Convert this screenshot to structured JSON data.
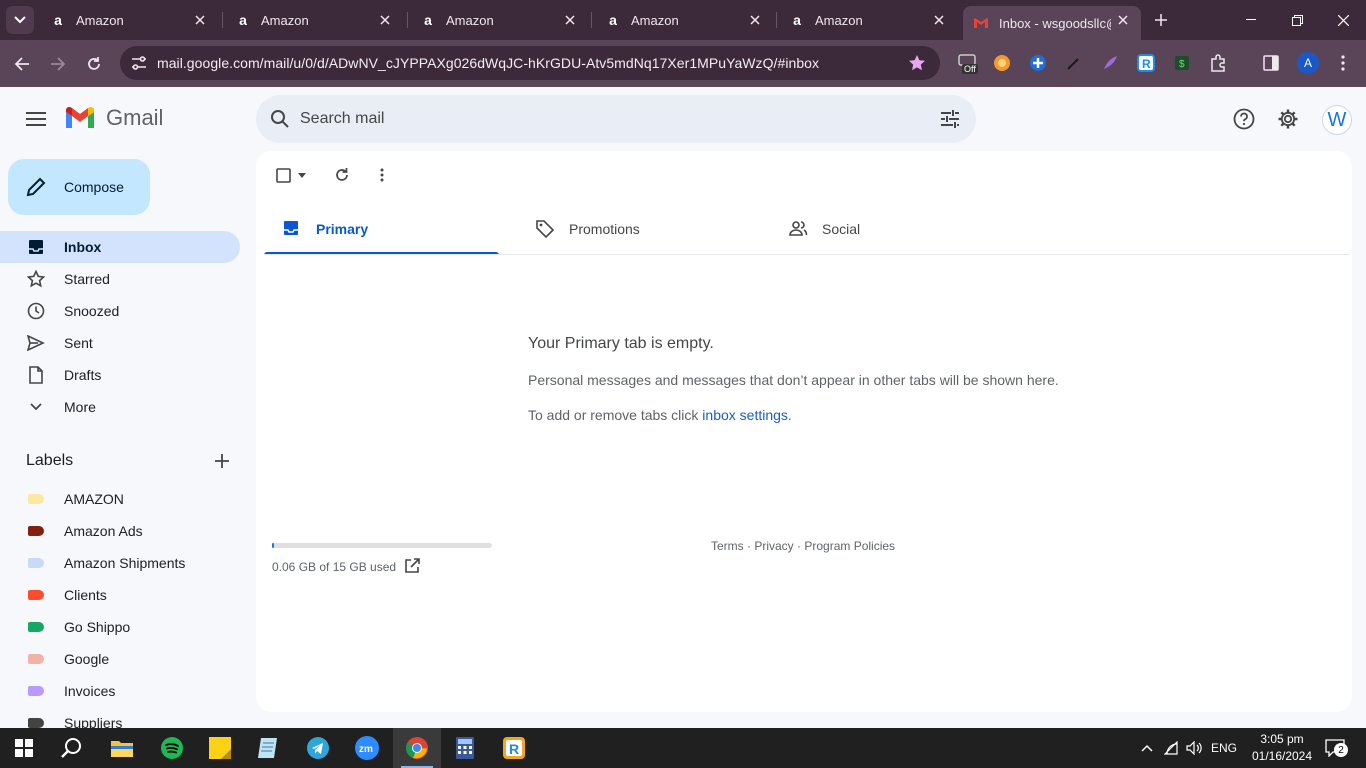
{
  "browser": {
    "tabs": [
      {
        "title": "Amazon",
        "favicon": "amazon-a-icon"
      },
      {
        "title": "Amazon",
        "favicon": "amazon-a-icon"
      },
      {
        "title": "Amazon",
        "favicon": "amazon-a-icon"
      },
      {
        "title": "Amazon",
        "favicon": "amazon-a-icon"
      },
      {
        "title": "Amazon",
        "favicon": "amazon-a-icon"
      },
      {
        "title": "Inbox - wsgoodsllc@",
        "favicon": "gmail-icon",
        "active": true
      }
    ],
    "url": "mail.google.com/mail/u/0/d/ADwNV_cJYPPAXg026dWqJC-hKrGDU-Atv5mdNq17Xer1MPuYaWzQ/#inbox",
    "extension_badge": "Off",
    "profile_initial": "A"
  },
  "gmail": {
    "logo_text": "Gmail",
    "search_placeholder": "Search mail",
    "avatar_initial": "W",
    "compose_label": "Compose",
    "nav": [
      {
        "label": "Inbox",
        "icon": "inbox-icon",
        "active": true
      },
      {
        "label": "Starred",
        "icon": "star-icon"
      },
      {
        "label": "Snoozed",
        "icon": "clock-icon"
      },
      {
        "label": "Sent",
        "icon": "send-icon"
      },
      {
        "label": "Drafts",
        "icon": "draft-icon"
      },
      {
        "label": "More",
        "icon": "chevron-down-icon"
      }
    ],
    "labels_header": "Labels",
    "labels": [
      {
        "name": "AMAZON",
        "color": "#fce8a3"
      },
      {
        "name": "Amazon Ads",
        "color": "#822111"
      },
      {
        "name": "Amazon Shipments",
        "color": "#c9daf8"
      },
      {
        "name": "Clients",
        "color": "#fb4c2f"
      },
      {
        "name": "Go Shippo",
        "color": "#16a765"
      },
      {
        "name": "Google",
        "color": "#f2b2a8"
      },
      {
        "name": "Invoices",
        "color": "#b99aff"
      },
      {
        "name": "Suppliers",
        "color": "#434343"
      }
    ],
    "category_tabs": [
      {
        "label": "Primary",
        "icon": "inbox-tab-icon",
        "active": true
      },
      {
        "label": "Promotions",
        "icon": "tag-icon"
      },
      {
        "label": "Social",
        "icon": "people-icon"
      }
    ],
    "empty_state": {
      "title": "Your Primary tab is empty.",
      "description": "Personal messages and messages that don’t appear in other tabs will be shown here.",
      "hint_prefix": "To add or remove tabs click ",
      "hint_link": "inbox settings",
      "hint_suffix": "."
    },
    "storage": {
      "text": "0.06 GB of 15 GB used",
      "used_fraction": 0.004
    },
    "footer": {
      "terms": "Terms",
      "privacy": "Privacy",
      "policies": "Program Policies",
      "separator": " · "
    }
  },
  "taskbar": {
    "language": "ENG",
    "time": "3:05 pm",
    "date": "01/16/2024",
    "notification_count": "2"
  },
  "colors": {
    "chrome_dark": "#3c2a3a",
    "chrome_toolbar": "#5a4558",
    "compose_bg": "#c2e7ff",
    "active_nav": "#d3e3fd",
    "accent": "#0b57d0"
  }
}
